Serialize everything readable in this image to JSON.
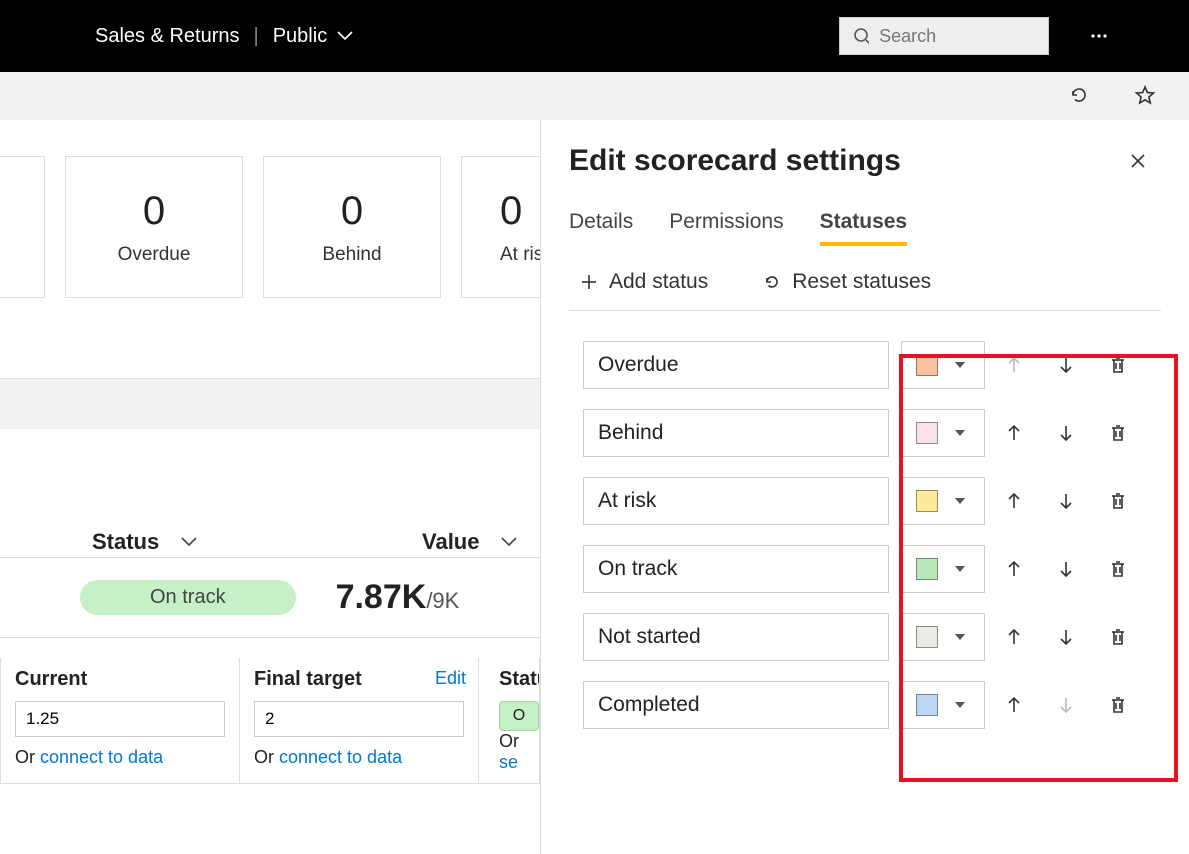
{
  "topbar": {
    "title": "Sales & Returns",
    "scope": "Public",
    "search_placeholder": "Search"
  },
  "cards": [
    {
      "label": "Overdue",
      "value": "0"
    },
    {
      "label": "Behind",
      "value": "0"
    },
    {
      "label": "At risk",
      "value": "0"
    }
  ],
  "table": {
    "col_status": "Status",
    "col_value": "Value",
    "pill_label": "On track",
    "value_main": "7.87K",
    "value_suffix": "/9K"
  },
  "details": {
    "current_label": "Current",
    "current_value": "1.25",
    "target_label": "Final target",
    "target_value": "2",
    "edit": "Edit",
    "or_prefix": "Or ",
    "connect": "connect to data",
    "status_label": "Statu",
    "status_short": "O",
    "se_prefix": "se"
  },
  "panel": {
    "title": "Edit scorecard settings",
    "tabs": [
      "Details",
      "Permissions",
      "Statuses"
    ],
    "active_tab": 2,
    "add_status": "Add status",
    "reset_statuses": "Reset statuses",
    "statuses": [
      {
        "name": "Overdue",
        "color": "#f8c1a0",
        "up_disabled": true,
        "down_disabled": false
      },
      {
        "name": "Behind",
        "color": "#fbe2e7",
        "up_disabled": false,
        "down_disabled": false
      },
      {
        "name": "At risk",
        "color": "#fcec9a",
        "up_disabled": false,
        "down_disabled": false
      },
      {
        "name": "On track",
        "color": "#b9e8b9",
        "up_disabled": false,
        "down_disabled": false
      },
      {
        "name": "Not started",
        "color": "#eceae7",
        "up_disabled": false,
        "down_disabled": false
      },
      {
        "name": "Completed",
        "color": "#bcd6f5",
        "up_disabled": false,
        "down_disabled": true
      }
    ]
  }
}
